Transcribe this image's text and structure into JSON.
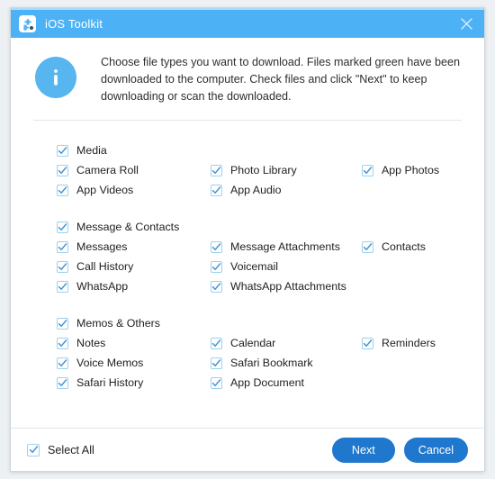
{
  "window": {
    "title": "iOS Toolkit",
    "app_icon": "puzzle-piece-icon",
    "close_icon": "close-icon",
    "titlebar_color": "#4db2f5"
  },
  "header": {
    "info_icon": "info-icon",
    "info_icon_color": "#57b6ef",
    "message": "Choose file types you want to download. Files marked green have been downloaded to the computer. Check files and click \"Next\" to keep downloading or scan the downloaded."
  },
  "groups": [
    {
      "name": "media",
      "header": {
        "label": "Media",
        "checked": true
      },
      "rows": [
        [
          {
            "label": "Camera Roll",
            "checked": true
          },
          {
            "label": "Photo Library",
            "checked": true
          },
          {
            "label": "App Photos",
            "checked": true
          }
        ],
        [
          {
            "label": "App Videos",
            "checked": true
          },
          {
            "label": "App Audio",
            "checked": true
          }
        ]
      ]
    },
    {
      "name": "message-contacts",
      "header": {
        "label": "Message & Contacts",
        "checked": true
      },
      "rows": [
        [
          {
            "label": "Messages",
            "checked": true
          },
          {
            "label": "Message Attachments",
            "checked": true
          },
          {
            "label": "Contacts",
            "checked": true
          }
        ],
        [
          {
            "label": "Call History",
            "checked": true
          },
          {
            "label": "Voicemail",
            "checked": true
          }
        ],
        [
          {
            "label": "WhatsApp",
            "checked": true
          },
          {
            "label": "WhatsApp Attachments",
            "checked": true
          }
        ]
      ]
    },
    {
      "name": "memos-others",
      "header": {
        "label": "Memos & Others",
        "checked": true
      },
      "rows": [
        [
          {
            "label": "Notes",
            "checked": true
          },
          {
            "label": "Calendar",
            "checked": true
          },
          {
            "label": "Reminders",
            "checked": true
          }
        ],
        [
          {
            "label": "Voice Memos",
            "checked": true
          },
          {
            "label": "Safari Bookmark",
            "checked": true
          }
        ],
        [
          {
            "label": "Safari History",
            "checked": true
          },
          {
            "label": "App Document",
            "checked": true
          }
        ]
      ]
    }
  ],
  "footer": {
    "select_all": {
      "label": "Select All",
      "checked": true
    },
    "next_label": "Next",
    "cancel_label": "Cancel",
    "button_color": "#1f78cd"
  }
}
